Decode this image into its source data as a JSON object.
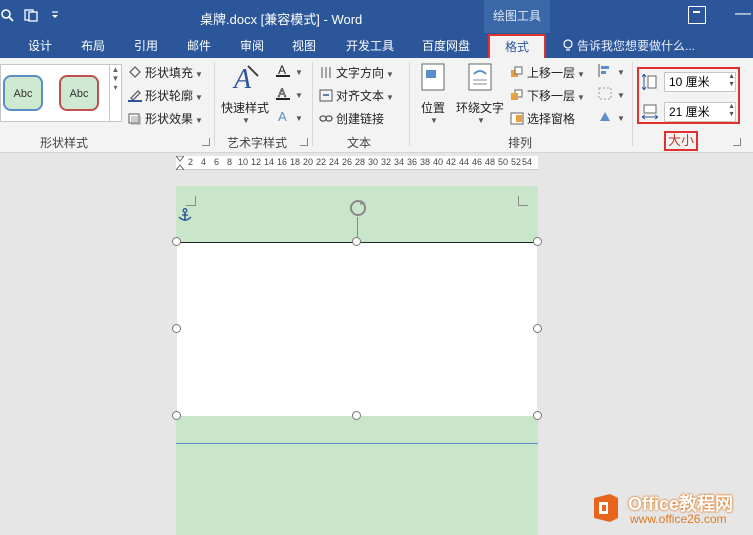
{
  "titlebar": {
    "title": "桌牌.docx [兼容模式] - Word",
    "context_tab_group": "绘图工具"
  },
  "tabs": [
    "设计",
    "布局",
    "引用",
    "邮件",
    "审阅",
    "视图",
    "开发工具",
    "百度网盘"
  ],
  "active_tab": "格式",
  "tell_me": "告诉我您想要做什么...",
  "ribbon": {
    "shape_styles": {
      "gallery": [
        "Abc",
        "Abc"
      ],
      "fill": "形状填充",
      "outline": "形状轮廓",
      "effects": "形状效果",
      "label": "形状样式"
    },
    "wordart": {
      "quick_styles": "快速样式",
      "label": "艺术字样式"
    },
    "text": {
      "direction": "文字方向",
      "align": "对齐文本",
      "link": "创建链接",
      "label": "文本"
    },
    "arrange": {
      "position": "位置",
      "wrap": "环绕文字",
      "bring_forward": "上移一层",
      "send_backward": "下移一层",
      "selection_pane": "选择窗格",
      "label": "排列"
    },
    "size": {
      "height": "10 厘米",
      "width": "21 厘米",
      "label": "大小"
    }
  },
  "ruler": [
    "2",
    "4",
    "6",
    "8",
    "10",
    "12",
    "14",
    "16",
    "18",
    "20",
    "22",
    "24",
    "26",
    "28",
    "30",
    "32",
    "34",
    "36",
    "38",
    "40",
    "42",
    "44",
    "46",
    "48",
    "50",
    "52",
    "54"
  ],
  "watermark": {
    "brand": "Office教程网",
    "url": "www.office26.com"
  },
  "colors": {
    "ribbon_blue": "#2b579a",
    "highlight_red": "#e03030",
    "page_green": "#c9e6ca"
  }
}
